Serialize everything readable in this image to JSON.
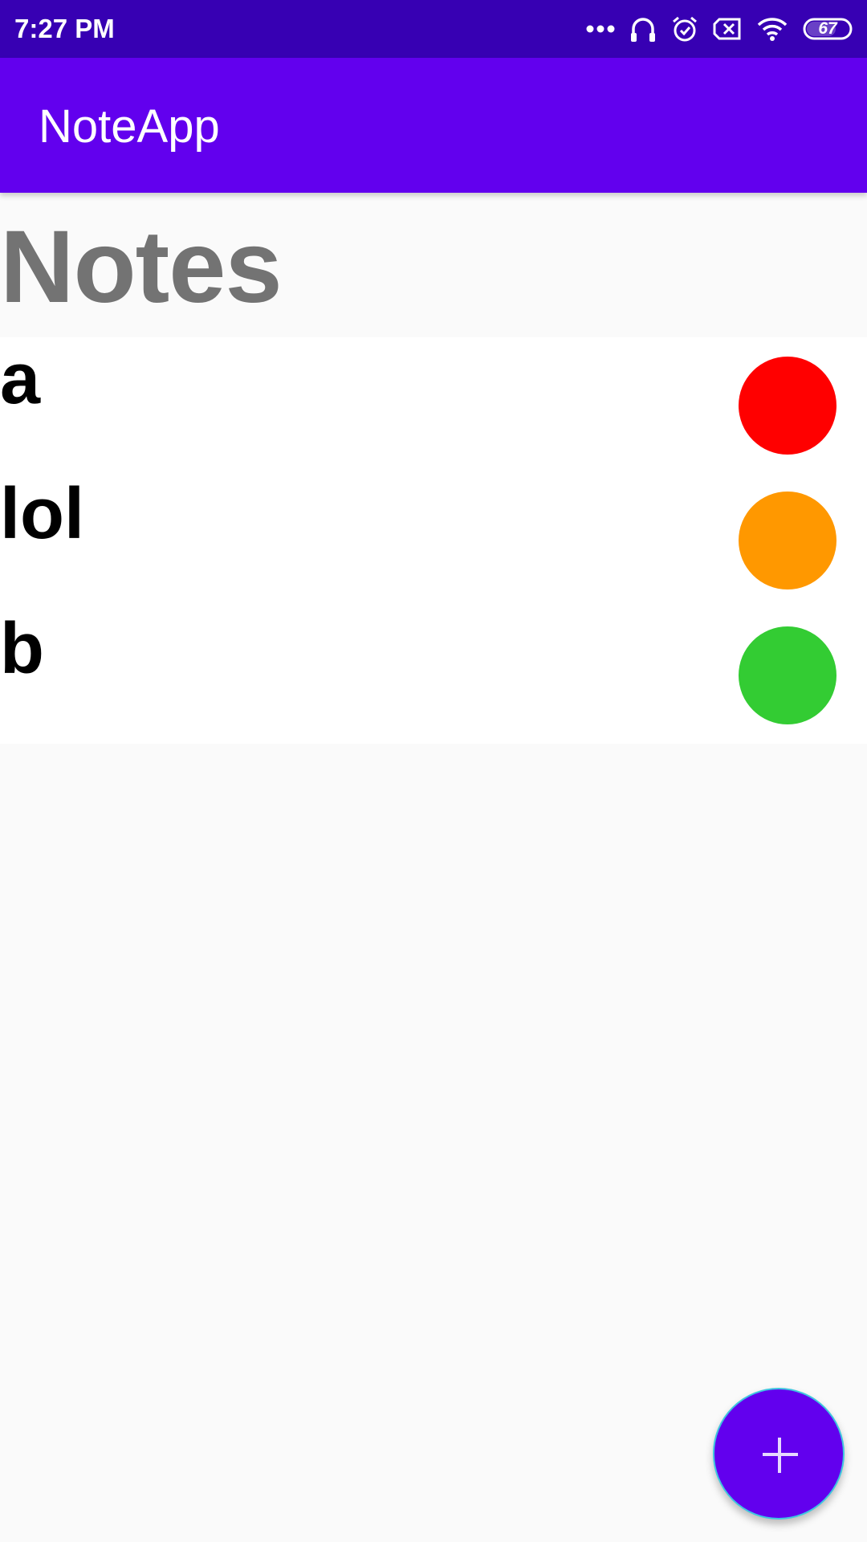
{
  "status_bar": {
    "time": "7:27 PM",
    "battery_level": "67",
    "icons": [
      "more-dots-icon",
      "headphones-icon",
      "alarm-icon",
      "sim-x-icon",
      "wifi-icon",
      "battery-icon"
    ]
  },
  "app_bar": {
    "title": "NoteApp",
    "color": "#6200ee"
  },
  "heading": "Notes",
  "notes": [
    {
      "title": "a",
      "color": "#ff0000"
    },
    {
      "title": "lol",
      "color": "#ff9800"
    },
    {
      "title": "b",
      "color": "#33cc33"
    }
  ],
  "fab": {
    "icon": "plus-icon",
    "color": "#6200ee"
  }
}
